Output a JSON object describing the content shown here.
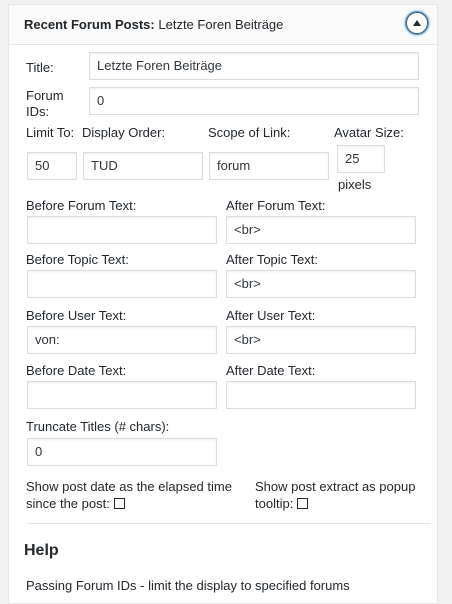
{
  "widget": {
    "title_strong": "Recent Forum Posts:",
    "title_rest": "Letzte Foren Beiträge",
    "toggle_icon": "arrow-up-icon"
  },
  "fields": {
    "title": {
      "label": "Title:",
      "value": "Letzte Foren Beiträge"
    },
    "forum_ids": {
      "label_line1": "Forum",
      "label_line2": "IDs:",
      "value": "0"
    },
    "limit": {
      "label": "Limit To:",
      "value": "50"
    },
    "display_order": {
      "label": "Display Order:",
      "value": "TUD"
    },
    "scope": {
      "label": "Scope of Link:",
      "value": "forum"
    },
    "avatar": {
      "label": "Avatar Size:",
      "value": "25",
      "unit": "pixels"
    },
    "before_forum": {
      "label": "Before Forum Text:",
      "value": ""
    },
    "after_forum": {
      "label": "After Forum Text:",
      "value": "<br>"
    },
    "before_topic": {
      "label": "Before Topic Text:",
      "value": ""
    },
    "after_topic": {
      "label": "After Topic Text:",
      "value": "<br>"
    },
    "before_user": {
      "label": "Before User Text:",
      "value": "von:"
    },
    "after_user": {
      "label": "After User Text:",
      "value": "<br>"
    },
    "before_date": {
      "label": "Before Date Text:",
      "value": ""
    },
    "after_date": {
      "label": "After Date Text:",
      "value": ""
    },
    "truncate": {
      "label": "Truncate Titles (# chars):",
      "value": "0"
    }
  },
  "checkboxes": {
    "elapsed": {
      "line1": "Show post date as the elapsed time",
      "line2": "since the post:",
      "checked": false
    },
    "popup": {
      "line1": "Show post extract as popup",
      "line2": "tooltip:",
      "checked": false
    }
  },
  "help": {
    "title": "Help",
    "text_strong": "Passing Forum IDs",
    "text_rest": " - limit the display to specified forums"
  }
}
